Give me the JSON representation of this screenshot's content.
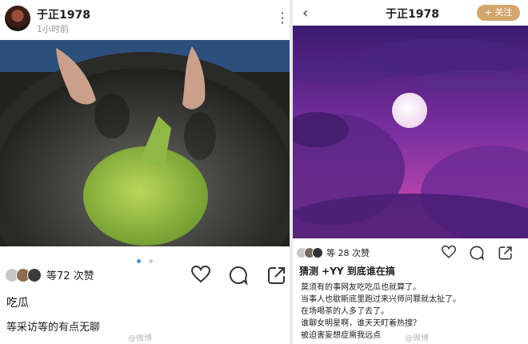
{
  "left": {
    "username": "于正1978",
    "time": "1小时前",
    "likes": "等72 次赞",
    "caption_title": "吃瓜",
    "caption_body": "等采访等的有点无聊",
    "watermark": "@微博"
  },
  "right": {
    "username": "于正1978",
    "follow_label": "+ 关注",
    "likes": "等 28 次赞",
    "caption_title": "猜测 +YY 到底谁在搞",
    "comments": [
      "莫须有的事网友吃吃瓜也就算了。",
      "当事人也歇斯底里跑过来兴师问罪就太扯了。",
      "在场喝茶的人多了去了。",
      "谁聊女明星啊，谁天天盯着热搜？",
      "被迫害妄想症需我远点"
    ],
    "watermark": "@微博"
  },
  "colors": {
    "accent": "#d4a56c",
    "active_dot": "#4a8ad4",
    "moon_sky": "#7a2fa0"
  },
  "icons": [
    "heart-icon",
    "comment-icon",
    "share-icon",
    "back-chevron-icon",
    "more-vertical-icon"
  ]
}
